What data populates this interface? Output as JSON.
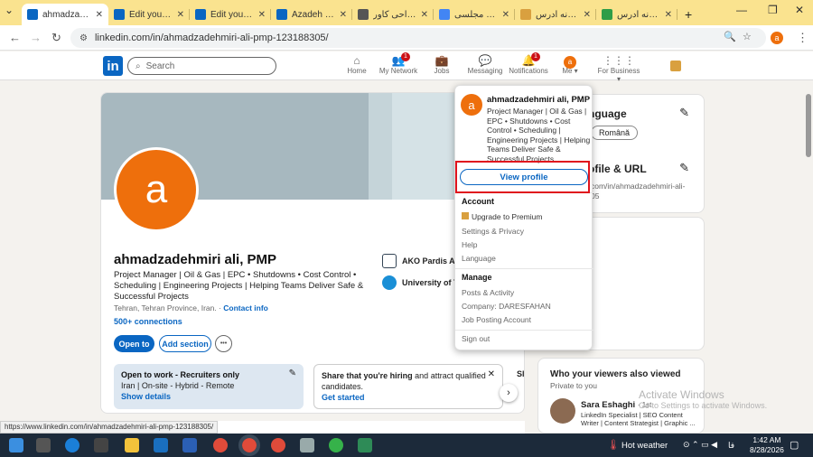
{
  "browser": {
    "tabs": [
      {
        "title": "ahmadzadehmiri ali, PMP | LinkedIn",
        "favicon": "linkedin-icon",
        "color": "#0a66c2",
        "active": true
      },
      {
        "title": "Edit your public profile",
        "favicon": "linkedin-icon",
        "color": "#0a66c2"
      },
      {
        "title": "Edit your public profile",
        "favicon": "linkedin-icon",
        "color": "#0a66c2"
      },
      {
        "title": "Azadeh Esha...",
        "favicon": "linkedin-icon",
        "color": "#0a66c2"
      },
      {
        "title": "طراحی کاور",
        "favicon": "globe-icon",
        "color": "#555555"
      },
      {
        "title": "شیک و مجلسی",
        "favicon": "google-icon",
        "color": "#4285f4"
      },
      {
        "title": "چگونه آدرس",
        "favicon": "page-icon",
        "color": "#d9a03f"
      },
      {
        "title": "چگونه آدرس",
        "favicon": "v-icon",
        "color": "#2e9d47"
      }
    ],
    "new_tab": "+",
    "url": "linkedin.com/in/ahmadzadehmiri-ali-pmp-123188305/",
    "status_url": "https://www.linkedin.com/in/ahmadzadehmiri-ali-pmp-123188305/",
    "profile_initial": "a"
  },
  "linkedin": {
    "logo": "in",
    "search_placeholder": "Search",
    "nav": [
      {
        "label": "Home",
        "icon": "home-icon",
        "badge": ""
      },
      {
        "label": "My Network",
        "icon": "network-icon",
        "badge": "1"
      },
      {
        "label": "Jobs",
        "icon": "briefcase-icon",
        "badge": ""
      },
      {
        "label": "Messaging",
        "icon": "messaging-icon",
        "badge": ""
      },
      {
        "label": "Notifications",
        "icon": "bell-icon",
        "badge": "1"
      },
      {
        "label": "Me",
        "icon": "avatar",
        "badge": ""
      },
      {
        "label": "For Business",
        "icon": "grid-icon",
        "badge": ""
      }
    ]
  },
  "profile": {
    "initial": "a",
    "name": "ahmadzadehmiri ali, PMP",
    "headline": "Project Manager | Oil & Gas | EPC • Shutdowns • Cost Control • Scheduling | Engineering Projects | Helping Teams Deliver Safe & Successful Projects",
    "location": "Tehran, Tehran Province, Iran.",
    "contact_info": "Contact info",
    "connections": "500+ connections",
    "orgs": [
      "AKO Pardis Aria",
      "University of Te"
    ],
    "open_to": "Open to",
    "add_section": "Add section",
    "more": "•••",
    "open_to_work": {
      "title": "Open to work - Recruiters only",
      "detail": "Iran | On-site - Hybrid - Remote",
      "link": "Show details"
    },
    "hiring": {
      "text_bold": "Share that you're hiring",
      "text": " and attract qualified candidates.",
      "link": "Get started"
    },
    "next_card_letter": "Sl"
  },
  "right": {
    "language_title": "nguage",
    "language_value": "Română",
    "url_title": "ofile & URL",
    "url_value": "com/in/ahmadzadehmiri-ali-",
    "url_value2": "05",
    "viewers_title": "Who your viewers also viewed",
    "viewers_sub": "Private to you",
    "viewer_name": "Sara Eshaghi",
    "viewer_degree": "· 1st",
    "viewer_headline": "LinkedIn Specialist | SEO Content Writer | Content Strategist | Graphic ..."
  },
  "menu": {
    "initial": "a",
    "name": "ahmadzadehmiri ali, PMP",
    "headline": "Project Manager | Oil & Gas | EPC • Shutdowns • Cost Control • Scheduling | Engineering Projects | Helping Teams Deliver Safe & Successful Projects",
    "view_profile": "View profile",
    "account_title": "Account",
    "premium": "Upgrade to Premium",
    "settings": "Settings & Privacy",
    "help": "Help",
    "language": "Language",
    "manage_title": "Manage",
    "posts": "Posts & Activity",
    "company": "Company: DARESFAHAN",
    "job_posting": "Job Posting Account",
    "signout": "Sign out"
  },
  "taskbar": {
    "weather": "Hot weather",
    "lang": "فا",
    "time": "1:42 AM",
    "date": "8/28/2026"
  },
  "watermark": {
    "line1": "Activate Windows",
    "line2": "Go to Settings to activate Windows."
  }
}
